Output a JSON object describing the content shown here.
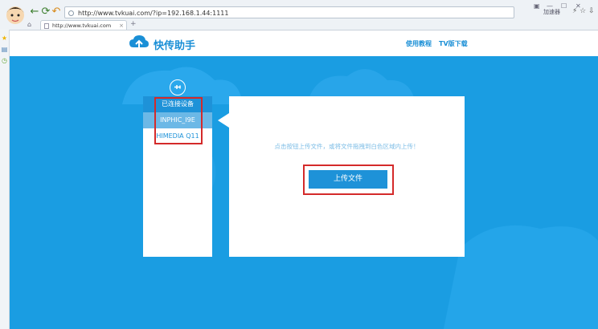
{
  "browser": {
    "url": "http://www.tvkuai.com/?ip=192.168.1.44:1111",
    "tab_title": "http://www.tvkuai.com",
    "accelerate_label": "加速器",
    "nav_icons": [
      "back-icon",
      "refresh-icon",
      "undo-icon"
    ]
  },
  "site": {
    "logo_text": "快传助手",
    "menu": [
      "使用教程",
      "TV版下载"
    ]
  },
  "devices": {
    "header": "已连接设备",
    "items": [
      "INPHIC_I9E",
      "HIMEDIA Q11"
    ],
    "selected_index": 0
  },
  "upload": {
    "hint": "点击按钮上传文件，或将文件拖拽到白色区域内上传！",
    "button_label": "上传文件"
  },
  "colors": {
    "background": "#1a9de2",
    "accent": "#1e92d8",
    "selected_item": "#6cb8e6",
    "annotation": "#d42a2a"
  }
}
